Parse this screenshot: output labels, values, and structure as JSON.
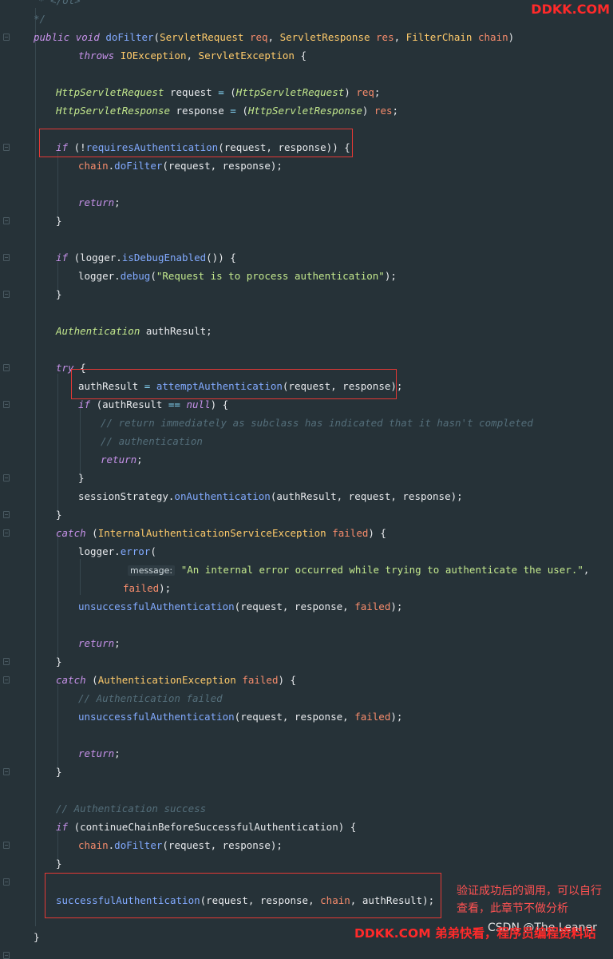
{
  "watermark_top": "DDKK.COM",
  "watermark_bottom": "DDKK.COM 弟弟快看，程序员编程资料站",
  "csdn_credit": "CSDN @The Leaner",
  "annotation_note": "验证成功后的调用，可以自行查看，此章节不做分析",
  "highlight_color": "#e53935",
  "icons": [
    "fold-marker-icon"
  ],
  "code": {
    "lines": [
      {
        "tokens": [
          [
            "cm",
            "* </ol>"
          ]
        ]
      },
      {
        "tokens": [
          [
            "cm",
            "*/"
          ]
        ]
      },
      {
        "tokens": [
          [
            "kw",
            "public"
          ],
          [
            "pl",
            " "
          ],
          [
            "kw",
            "void"
          ],
          [
            "pl",
            " "
          ],
          [
            "fn",
            "doFilter"
          ],
          [
            "pl",
            "("
          ],
          [
            "tyn",
            "ServletRequest"
          ],
          [
            "pl",
            " "
          ],
          [
            "pa",
            "req"
          ],
          [
            "pl",
            ", "
          ],
          [
            "tyn",
            "ServletResponse"
          ],
          [
            "pl",
            " "
          ],
          [
            "pa",
            "res"
          ],
          [
            "pl",
            ", "
          ],
          [
            "tyn",
            "FilterChain"
          ],
          [
            "pl",
            " "
          ],
          [
            "pa",
            "chain"
          ],
          [
            "pl",
            ")"
          ]
        ]
      },
      {
        "tokens": [
          [
            "kw",
            "throws"
          ],
          [
            "pl",
            " "
          ],
          [
            "tyn",
            "IOException"
          ],
          [
            "pl",
            ", "
          ],
          [
            "tyn",
            "ServletException"
          ],
          [
            "pl",
            " {"
          ]
        ]
      },
      {
        "tokens": []
      },
      {
        "tokens": [
          [
            "ty",
            "HttpServletRequest"
          ],
          [
            "pl",
            " request "
          ],
          [
            "op",
            "="
          ],
          [
            "pl",
            " ("
          ],
          [
            "ty",
            "HttpServletRequest"
          ],
          [
            "pl",
            ") "
          ],
          [
            "pa",
            "req"
          ],
          [
            "pl",
            ";"
          ]
        ]
      },
      {
        "tokens": [
          [
            "ty",
            "HttpServletResponse"
          ],
          [
            "pl",
            " response "
          ],
          [
            "op",
            "="
          ],
          [
            "pl",
            " ("
          ],
          [
            "ty",
            "HttpServletResponse"
          ],
          [
            "pl",
            ") "
          ],
          [
            "pa",
            "res"
          ],
          [
            "pl",
            ";"
          ]
        ]
      },
      {
        "tokens": []
      },
      {
        "tokens": [
          [
            "kw",
            "if"
          ],
          [
            "pl",
            " (!"
          ],
          [
            "fn",
            "requiresAuthentication"
          ],
          [
            "pl",
            "(request, response)) {"
          ]
        ]
      },
      {
        "tokens": [
          [
            "pa",
            "chain"
          ],
          [
            "pl",
            "."
          ],
          [
            "fn",
            "doFilter"
          ],
          [
            "pl",
            "(request, response);"
          ]
        ]
      },
      {
        "tokens": []
      },
      {
        "tokens": [
          [
            "kw",
            "return"
          ],
          [
            "pl",
            ";"
          ]
        ]
      },
      {
        "tokens": [
          [
            "pl",
            "}"
          ]
        ]
      },
      {
        "tokens": []
      },
      {
        "tokens": [
          [
            "kw",
            "if"
          ],
          [
            "pl",
            " (logger."
          ],
          [
            "fn",
            "isDebugEnabled"
          ],
          [
            "pl",
            "()) {"
          ]
        ]
      },
      {
        "tokens": [
          [
            "pl",
            "logger."
          ],
          [
            "fn",
            "debug"
          ],
          [
            "pl",
            "("
          ],
          [
            "str",
            "\"Request is to process authentication\""
          ],
          [
            "pl",
            ");"
          ]
        ]
      },
      {
        "tokens": [
          [
            "pl",
            "}"
          ]
        ]
      },
      {
        "tokens": []
      },
      {
        "tokens": [
          [
            "ty",
            "Authentication"
          ],
          [
            "pl",
            " authResult;"
          ]
        ]
      },
      {
        "tokens": []
      },
      {
        "tokens": [
          [
            "kw",
            "try"
          ],
          [
            "pl",
            " {"
          ]
        ]
      },
      {
        "tokens": [
          [
            "pl",
            "authResult "
          ],
          [
            "op",
            "="
          ],
          [
            "pl",
            " "
          ],
          [
            "fn",
            "attemptAuthentication"
          ],
          [
            "pl",
            "(request, response);"
          ]
        ]
      },
      {
        "tokens": [
          [
            "kw",
            "if"
          ],
          [
            "pl",
            " (authResult "
          ],
          [
            "op",
            "=="
          ],
          [
            "pl",
            " "
          ],
          [
            "kw",
            "null"
          ],
          [
            "pl",
            ") {"
          ]
        ]
      },
      {
        "tokens": [
          [
            "cm",
            "// return immediately as subclass has indicated that it hasn't completed"
          ]
        ]
      },
      {
        "tokens": [
          [
            "cm",
            "// authentication"
          ]
        ]
      },
      {
        "tokens": [
          [
            "kw",
            "return"
          ],
          [
            "pl",
            ";"
          ]
        ]
      },
      {
        "tokens": [
          [
            "pl",
            "}"
          ]
        ]
      },
      {
        "tokens": [
          [
            "pl",
            "sessionStrategy."
          ],
          [
            "fn",
            "onAuthentication"
          ],
          [
            "pl",
            "(authResult, request, response);"
          ]
        ]
      },
      {
        "tokens": [
          [
            "pl",
            "}"
          ]
        ]
      },
      {
        "tokens": [
          [
            "kw",
            "catch"
          ],
          [
            "pl",
            " ("
          ],
          [
            "tyn",
            "InternalAuthenticationServiceException"
          ],
          [
            "pl",
            " "
          ],
          [
            "pa",
            "failed"
          ],
          [
            "pl",
            ") {"
          ]
        ]
      },
      {
        "tokens": [
          [
            "pl",
            "logger."
          ],
          [
            "fn",
            "error"
          ],
          [
            "pl",
            "("
          ]
        ]
      },
      {
        "tokens": [
          [
            "hint",
            "message:"
          ],
          [
            "pl",
            " "
          ],
          [
            "str",
            "\"An internal error occurred while trying to authenticate the user.\""
          ],
          [
            "pl",
            ","
          ]
        ]
      },
      {
        "tokens": [
          [
            "pa",
            "failed"
          ],
          [
            "pl",
            ");"
          ]
        ]
      },
      {
        "tokens": [
          [
            "fn",
            "unsuccessfulAuthentication"
          ],
          [
            "pl",
            "(request, response, "
          ],
          [
            "pa",
            "failed"
          ],
          [
            "pl",
            ");"
          ]
        ]
      },
      {
        "tokens": []
      },
      {
        "tokens": [
          [
            "kw",
            "return"
          ],
          [
            "pl",
            ";"
          ]
        ]
      },
      {
        "tokens": [
          [
            "pl",
            "}"
          ]
        ]
      },
      {
        "tokens": [
          [
            "kw",
            "catch"
          ],
          [
            "pl",
            " ("
          ],
          [
            "tyn",
            "AuthenticationException"
          ],
          [
            "pl",
            " "
          ],
          [
            "pa",
            "failed"
          ],
          [
            "pl",
            ") {"
          ]
        ]
      },
      {
        "tokens": [
          [
            "cm",
            "// Authentication failed"
          ]
        ]
      },
      {
        "tokens": [
          [
            "fn",
            "unsuccessfulAuthentication"
          ],
          [
            "pl",
            "(request, response, "
          ],
          [
            "pa",
            "failed"
          ],
          [
            "pl",
            ");"
          ]
        ]
      },
      {
        "tokens": []
      },
      {
        "tokens": [
          [
            "kw",
            "return"
          ],
          [
            "pl",
            ";"
          ]
        ]
      },
      {
        "tokens": [
          [
            "pl",
            "}"
          ]
        ]
      },
      {
        "tokens": []
      },
      {
        "tokens": [
          [
            "cm",
            "// Authentication success"
          ]
        ]
      },
      {
        "tokens": [
          [
            "kw",
            "if"
          ],
          [
            "pl",
            " (continueChainBeforeSuccessfulAuthentication) {"
          ]
        ]
      },
      {
        "tokens": [
          [
            "pa",
            "chain"
          ],
          [
            "pl",
            "."
          ],
          [
            "fn",
            "doFilter"
          ],
          [
            "pl",
            "(request, response);"
          ]
        ]
      },
      {
        "tokens": [
          [
            "pl",
            "}"
          ]
        ]
      },
      {
        "tokens": []
      },
      {
        "tokens": [
          [
            "fn",
            "successfulAuthentication"
          ],
          [
            "pl",
            "(request, response, "
          ],
          [
            "pa",
            "chain"
          ],
          [
            "pl",
            ", authResult);"
          ]
        ]
      },
      {
        "tokens": []
      },
      {
        "tokens": [
          [
            "pl",
            "}"
          ]
        ]
      }
    ]
  }
}
